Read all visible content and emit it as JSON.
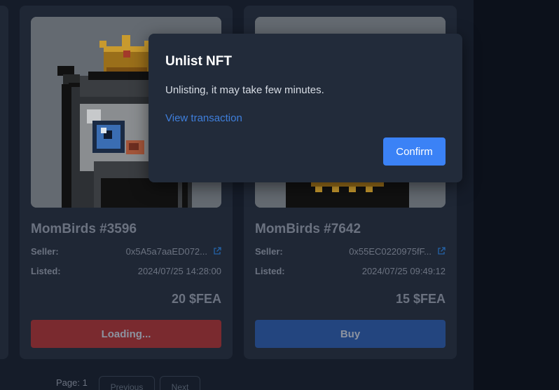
{
  "cards": [
    {
      "name": "MomBirds #3596",
      "seller_label": "Seller:",
      "seller_value": "0x5A5a7aaED072...",
      "listed_label": "Listed:",
      "listed_value": "2024/07/25 14:28:00",
      "price": "20 $FEA",
      "action_label": "Loading..."
    },
    {
      "name": "MomBirds #7642",
      "seller_label": "Seller:",
      "seller_value": "0x55EC0220975fF...",
      "listed_label": "Listed:",
      "listed_value": "2024/07/25 09:49:12",
      "price": "15 $FEA",
      "action_label": "Buy"
    }
  ],
  "pagination": {
    "page_label": "Page: 1",
    "previous_label": "Previous",
    "next_label": "Next"
  },
  "modal": {
    "title": "Unlist NFT",
    "message": "Unlisting, it may take few minutes.",
    "link_label": "View transaction",
    "confirm_label": "Confirm"
  },
  "colors": {
    "loading_button": "#7a2a2f",
    "buy_button": "#23457f",
    "confirm_button": "#3b82f6",
    "link": "#3f7fdc"
  },
  "icons": {
    "seller_link": "external-link-icon"
  }
}
